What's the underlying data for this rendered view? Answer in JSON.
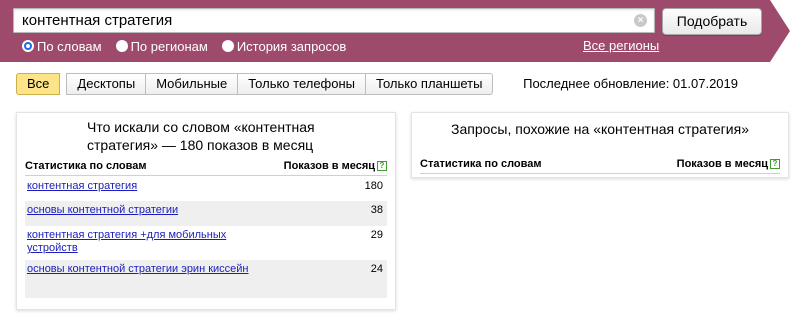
{
  "search": {
    "query": "контентная стратегия",
    "button_label": "Подобрать"
  },
  "search_modes": [
    {
      "label": "По словам",
      "checked": true
    },
    {
      "label": "По регионам",
      "checked": false
    },
    {
      "label": "История запросов",
      "checked": false
    }
  ],
  "all_regions_label": "Все регионы",
  "device_tabs": [
    {
      "label": "Все",
      "active": true
    },
    {
      "label": "Десктопы",
      "active": false
    },
    {
      "label": "Мобильные",
      "active": false
    },
    {
      "label": "Только телефоны",
      "active": false
    },
    {
      "label": "Только планшеты",
      "active": false
    }
  ],
  "last_update": "Последнее обновление: 01.07.2019",
  "left_panel": {
    "title": "Что искали со словом «контентная стратегия» — 180 показов в месяц",
    "col_stat": "Статистика по словам",
    "col_shows": "Показов в месяц",
    "rows": [
      {
        "phrase": "контентная стратегия",
        "count": "180"
      },
      {
        "phrase": "основы контентной стратегии",
        "count": "38"
      },
      {
        "phrase": "контентная стратегия +для мобильных устройств",
        "count": "29"
      },
      {
        "phrase": "основы контентной стратегии эрин киссейн",
        "count": "24"
      }
    ]
  },
  "right_panel": {
    "title": "Запросы, похожие на «контентная стратегия»",
    "col_stat": "Статистика по словам",
    "col_shows": "Показов в месяц"
  },
  "colors": {
    "header_band": "#9e4a6d",
    "active_tab": "#fde489",
    "link": "#1a1dbb",
    "help_icon": "#3f9d2b"
  }
}
